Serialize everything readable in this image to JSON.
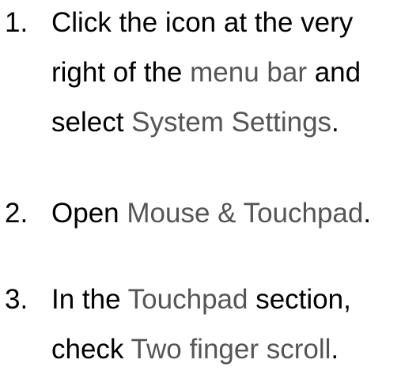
{
  "steps": [
    {
      "number": "1.",
      "lines": [
        {
          "text_a": "Click the icon at the very"
        },
        {
          "text_a": "right of the ",
          "term": "menu bar",
          "text_b": " and"
        },
        {
          "term": "System Settings",
          "text_a": "select ",
          "text_b": "."
        }
      ]
    },
    {
      "number": "2.",
      "lines": [
        {
          "text_a": "Open ",
          "term": "Mouse & Touchpad",
          "text_b": "."
        }
      ]
    },
    {
      "number": "3.",
      "lines": [
        {
          "text_a": "In the ",
          "term": "Touchpad",
          "text_b": " section,"
        },
        {
          "text_a": "check ",
          "term": "Two finger scroll",
          "text_b": "."
        }
      ]
    }
  ],
  "colors": {
    "text": "#000000",
    "ui_term": "#555555",
    "background": "#ffffff"
  }
}
